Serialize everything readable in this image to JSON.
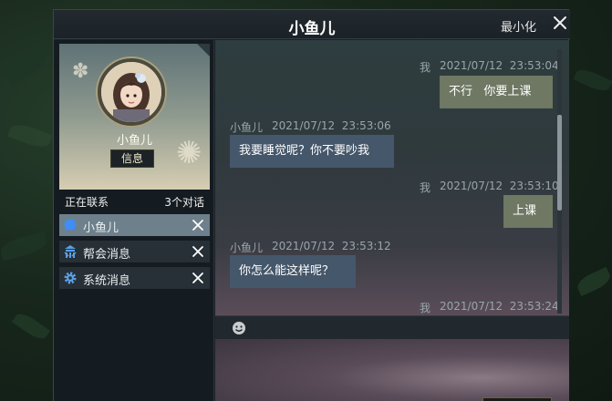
{
  "window": {
    "title": "小鱼儿",
    "minimize_label": "最小化"
  },
  "profile": {
    "name": "小鱼儿",
    "info_button": "信息"
  },
  "contacts_header": {
    "label": "正在联系",
    "count": "3个对话"
  },
  "contacts": [
    {
      "label": "小鱼儿",
      "icon": "chat-bubble-icon",
      "active": true
    },
    {
      "label": "帮会消息",
      "icon": "guild-icon",
      "active": false
    },
    {
      "label": "系统消息",
      "icon": "gear-icon",
      "active": false
    }
  ],
  "messages": [
    {
      "sender": "我",
      "time": "2021/07/12  23:53:04",
      "text": "不行   你要上课",
      "self": true
    },
    {
      "sender": "小鱼儿",
      "time": "2021/07/12  23:53:06",
      "text": "我要睡觉呢？你不要吵我",
      "self": false
    },
    {
      "sender": "我",
      "time": "2021/07/12  23:53:10",
      "text": "上课",
      "self": true
    },
    {
      "sender": "小鱼儿",
      "time": "2021/07/12  23:53:12",
      "text": "你怎么能这样呢？",
      "self": false
    },
    {
      "sender": "我",
      "time": "2021/07/12  23:53:24",
      "text": "",
      "self": true
    }
  ],
  "colors": {
    "self_bubble": "#6e7863",
    "other_bubble": "#45576a",
    "active_contact": "#6d808b"
  }
}
